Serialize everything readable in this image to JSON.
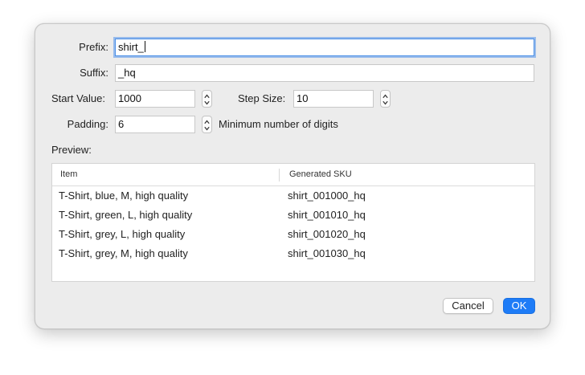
{
  "form": {
    "prefix_label": "Prefix:",
    "prefix_value": "shirt_",
    "suffix_label": "Suffix:",
    "suffix_value": "_hq",
    "start_label": "Start Value:",
    "start_value": "1000",
    "step_label": "Step Size:",
    "step_value": "10",
    "padding_label": "Padding:",
    "padding_value": "6",
    "padding_hint": "Minimum number of digits"
  },
  "preview": {
    "label": "Preview:",
    "columns": [
      "Item",
      "Generated SKU"
    ],
    "rows": [
      [
        "T-Shirt, blue, M, high quality",
        "shirt_001000_hq"
      ],
      [
        "T-Shirt, green, L, high quality",
        "shirt_001010_hq"
      ],
      [
        "T-Shirt, grey, L, high quality",
        "shirt_001020_hq"
      ],
      [
        "T-Shirt, grey, M, high quality",
        "shirt_001030_hq"
      ]
    ]
  },
  "buttons": {
    "cancel": "Cancel",
    "ok": "OK"
  },
  "colors": {
    "accent": "#1e7cf7",
    "focus_ring": "#4a8fe6",
    "dialog_bg": "#ececec"
  },
  "icons": {
    "stepper": "up-down-chevron-icon"
  }
}
